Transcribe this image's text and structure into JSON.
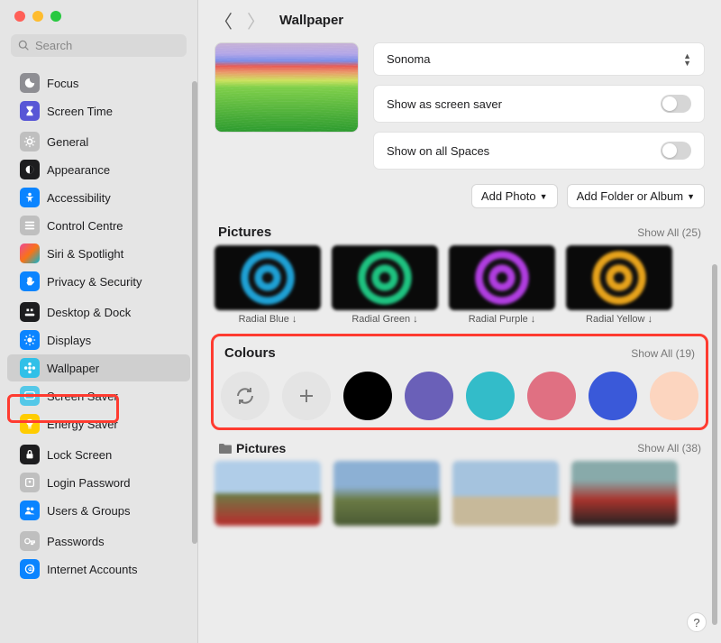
{
  "search": {
    "placeholder": "Search"
  },
  "header": {
    "title": "Wallpaper"
  },
  "sidebar": {
    "groups": [
      {
        "items": [
          {
            "label": "Focus",
            "icon": "moon",
            "bg": "#8e8e93"
          },
          {
            "label": "Screen Time",
            "icon": "hourglass",
            "bg": "#5856d6"
          }
        ]
      },
      {
        "items": [
          {
            "label": "General",
            "icon": "gear",
            "bg": "#bfbfbf"
          },
          {
            "label": "Appearance",
            "icon": "appearance",
            "bg": "#1d1d1f"
          },
          {
            "label": "Accessibility",
            "icon": "accessibility",
            "bg": "#0a84ff"
          },
          {
            "label": "Control Centre",
            "icon": "control",
            "bg": "#bfbfbf"
          },
          {
            "label": "Siri & Spotlight",
            "icon": "siri",
            "bg": "grad1"
          },
          {
            "label": "Privacy & Security",
            "icon": "hand",
            "bg": "#0a84ff"
          }
        ]
      },
      {
        "items": [
          {
            "label": "Desktop & Dock",
            "icon": "dock",
            "bg": "#1d1d1f"
          },
          {
            "label": "Displays",
            "icon": "displays",
            "bg": "#0a84ff"
          },
          {
            "label": "Wallpaper",
            "icon": "wallpaper",
            "bg": "#30c0e8",
            "selected": true
          },
          {
            "label": "Screen Saver",
            "icon": "screensaver",
            "bg": "#54c8e8"
          },
          {
            "label": "Energy Saver",
            "icon": "energy",
            "bg": "#ffcc00"
          }
        ]
      },
      {
        "items": [
          {
            "label": "Lock Screen",
            "icon": "lock",
            "bg": "#1d1d1f"
          },
          {
            "label": "Login Password",
            "icon": "key",
            "bg": "#bfbfbf"
          },
          {
            "label": "Users & Groups",
            "icon": "users",
            "bg": "#0a84ff"
          }
        ]
      },
      {
        "items": [
          {
            "label": "Passwords",
            "icon": "passkey",
            "bg": "#bfbfbf"
          },
          {
            "label": "Internet Accounts",
            "icon": "at",
            "bg": "#0a84ff"
          }
        ]
      }
    ]
  },
  "wallpaper": {
    "dropdown": "Sonoma",
    "screensaver_label": "Show as screen saver",
    "spaces_label": "Show on all Spaces"
  },
  "buttons": {
    "add_photo": "Add Photo",
    "add_folder": "Add Folder or Album"
  },
  "sections": {
    "pictures": {
      "title": "Pictures",
      "showall": "Show All  (25)",
      "thumbs": [
        {
          "name": "Radial Blue",
          "tint": "#1ea0d4"
        },
        {
          "name": "Radial Green",
          "tint": "#1ec280"
        },
        {
          "name": "Radial Purple",
          "tint": "#b03de0"
        },
        {
          "name": "Radial Yellow",
          "tint": "#e6a21b"
        }
      ]
    },
    "colours": {
      "title": "Colours",
      "showall": "Show All  (19)",
      "swatches": [
        "#000000",
        "#6a60b8",
        "#33bcc9",
        "#e07082",
        "#3a59d9",
        "#fcd5bf"
      ]
    },
    "folder_pictures": {
      "title": "Pictures",
      "showall": "Show All  (38)"
    }
  },
  "help": "?"
}
